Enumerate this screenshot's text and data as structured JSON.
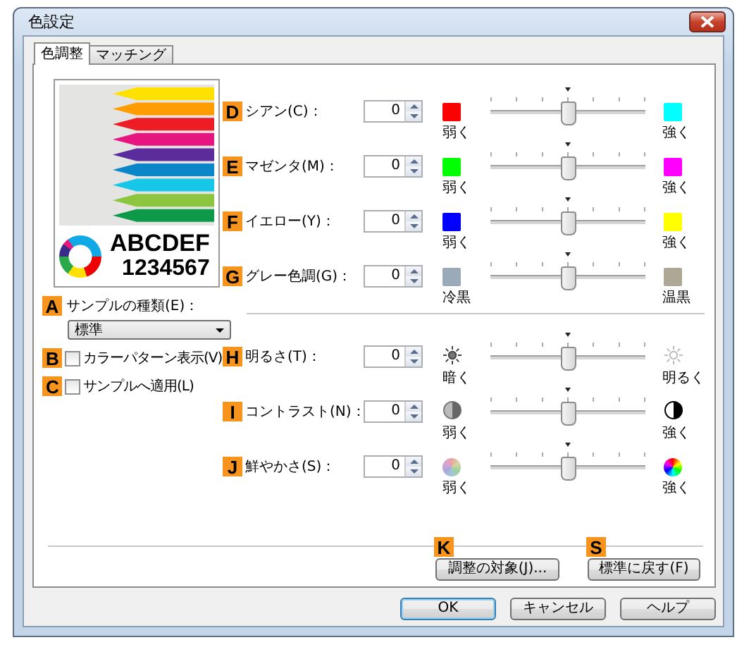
{
  "window": {
    "title": "色設定"
  },
  "tabs": [
    {
      "label": "色調整",
      "selected": true
    },
    {
      "label": "マッチング",
      "selected": false
    }
  ],
  "sample_preview": {
    "text_1": "ABCDEF",
    "text_2": "1234567"
  },
  "sample_type": {
    "badge": "A",
    "label": "サンプルの種類(E)：",
    "value": "標準"
  },
  "options": [
    {
      "badge": "B",
      "label": "カラーパターン表示(V)",
      "checked": false
    },
    {
      "badge": "C",
      "label": "サンプルへ適用(L)",
      "checked": false
    }
  ],
  "color_balance": [
    {
      "badge": "D",
      "label": "シアン(C)：",
      "value": "0",
      "kind": "swatch",
      "low_swatch": {
        "color": "#ff0000"
      },
      "high_swatch": {
        "color": "#00ffff"
      },
      "low_label": "弱く",
      "high_label": "強く",
      "level": 0.5
    },
    {
      "badge": "E",
      "label": "マゼンタ(M)：",
      "value": "0",
      "kind": "swatch",
      "low_swatch": {
        "color": "#00ff00"
      },
      "high_swatch": {
        "color": "#ff00ff"
      },
      "low_label": "弱く",
      "high_label": "強く",
      "level": 0.5
    },
    {
      "badge": "F",
      "label": "イエロー(Y)：",
      "value": "0",
      "kind": "swatch",
      "low_swatch": {
        "color": "#0000ff"
      },
      "high_swatch": {
        "color": "#ffff00"
      },
      "low_label": "弱く",
      "high_label": "強く",
      "level": 0.5
    },
    {
      "badge": "G",
      "label": "グレー色調(G)：",
      "value": "0",
      "kind": "swatch",
      "low_swatch": {
        "color": "#9aaab8"
      },
      "high_swatch": {
        "color": "#aea796"
      },
      "low_label": "冷黒",
      "high_label": "温黒",
      "level": 0.5
    }
  ],
  "tone": [
    {
      "badge": "H",
      "label": "明るさ(T)：",
      "value": "0",
      "kind": "brightness",
      "low_label": "暗く",
      "high_label": "明るく",
      "level": 0.5
    },
    {
      "badge": "I",
      "label": "コントラスト(N)：",
      "value": "0",
      "kind": "contrast",
      "low_label": "弱く",
      "high_label": "強く",
      "level": 0.5
    },
    {
      "badge": "J",
      "label": "鮮やかさ(S)：",
      "value": "0",
      "kind": "saturation",
      "low_label": "弱く",
      "high_label": "強く",
      "level": 0.5
    }
  ],
  "actions": [
    {
      "badge": "K",
      "label": "調整の対象(J)..."
    },
    {
      "badge": "S",
      "label": "標準に戻す(F)"
    }
  ],
  "buttons": [
    {
      "label": "OK",
      "default": true
    },
    {
      "label": "キャンセル",
      "default": false
    },
    {
      "label": "ヘルプ",
      "default": false
    }
  ]
}
